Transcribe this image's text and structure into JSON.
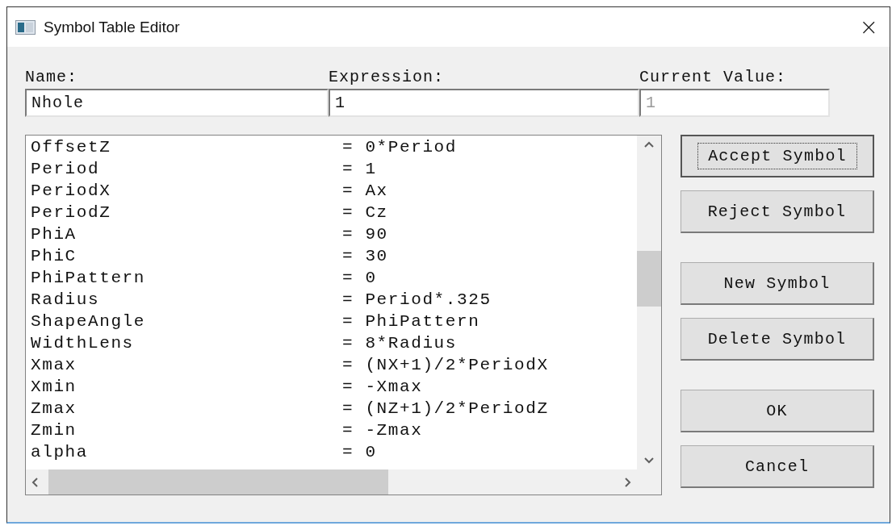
{
  "window": {
    "title": "Symbol Table Editor",
    "close": "×"
  },
  "fields": [
    {
      "label": "Name:",
      "value": "Nhole",
      "disabled": false
    },
    {
      "label": "Expression:",
      "value": "1",
      "disabled": false
    },
    {
      "label": "Current Value:",
      "value": "1",
      "disabled": true
    }
  ],
  "symbols": [
    {
      "name": "OffsetZ",
      "expression": "= 0*Period"
    },
    {
      "name": "Period",
      "expression": "= 1"
    },
    {
      "name": "PeriodX",
      "expression": "= Ax"
    },
    {
      "name": "PeriodZ",
      "expression": "= Cz"
    },
    {
      "name": "PhiA",
      "expression": "= 90"
    },
    {
      "name": "PhiC",
      "expression": "= 30"
    },
    {
      "name": "PhiPattern",
      "expression": "= 0"
    },
    {
      "name": "Radius",
      "expression": "= Period*.325"
    },
    {
      "name": "ShapeAngle",
      "expression": "= PhiPattern"
    },
    {
      "name": "WidthLens",
      "expression": "= 8*Radius"
    },
    {
      "name": "Xmax",
      "expression": "= (NX+1)/2*PeriodX"
    },
    {
      "name": "Xmin",
      "expression": "= -Xmax"
    },
    {
      "name": "Zmax",
      "expression": "= (NZ+1)/2*PeriodZ"
    },
    {
      "name": "Zmin",
      "expression": "= -Zmax"
    },
    {
      "name": "alpha",
      "expression": "= 0"
    }
  ],
  "buttons": [
    {
      "label": "Accept Symbol",
      "default": true
    },
    {
      "label": "Reject Symbol",
      "default": false
    },
    {
      "label": "New Symbol",
      "default": false
    },
    {
      "label": "Delete Symbol",
      "default": false
    },
    {
      "label": "OK",
      "default": false
    },
    {
      "label": "Cancel",
      "default": false
    }
  ]
}
